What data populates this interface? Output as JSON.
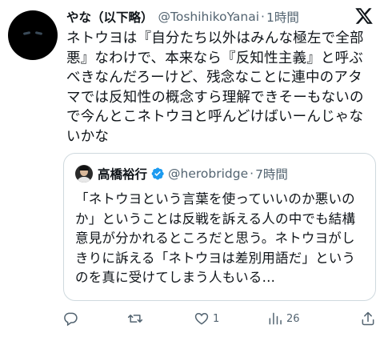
{
  "tweet": {
    "display_name": "やな（以下略）",
    "handle": "@ToshihikoYanai",
    "separator": "·",
    "time": "1時間",
    "text": "ネトウヨは『自分たち以外はみんな極左で全部悪』なわけで、本来なら『反知性主義』と呼ぶべきなんだろーけど、残念なことに連中のアタマでは反知性の概念すら理解できそーもないので今んとこネトウヨと呼んどけばいーんじゃないかな"
  },
  "quoted_tweet": {
    "display_name": "高橋裕行",
    "handle": "@herobridge",
    "separator": "·",
    "time": "7時間",
    "text": "「ネトウヨという言葉を使っていいのか悪いのか」ということは反戦を訴える人の中でも結構意見が分かれるところだと思う。ネトウヨがしきりに訴える「ネトウヨは差別用語だ」というのを真に受けてしまう人もいる…"
  },
  "actions": {
    "reply_count": "",
    "retweet_count": "",
    "like_count": "1",
    "view_count": "26"
  },
  "icons": {
    "logo": "x-logo-icon",
    "verified": "verified-badge-icon",
    "reply": "reply-icon",
    "retweet": "retweet-icon",
    "like": "heart-icon",
    "views": "views-chart-icon",
    "share": "share-icon"
  },
  "colors": {
    "text": "#0f1419",
    "secondary": "#536471",
    "border": "#cfd9de",
    "verified": "#1d9bf0"
  }
}
